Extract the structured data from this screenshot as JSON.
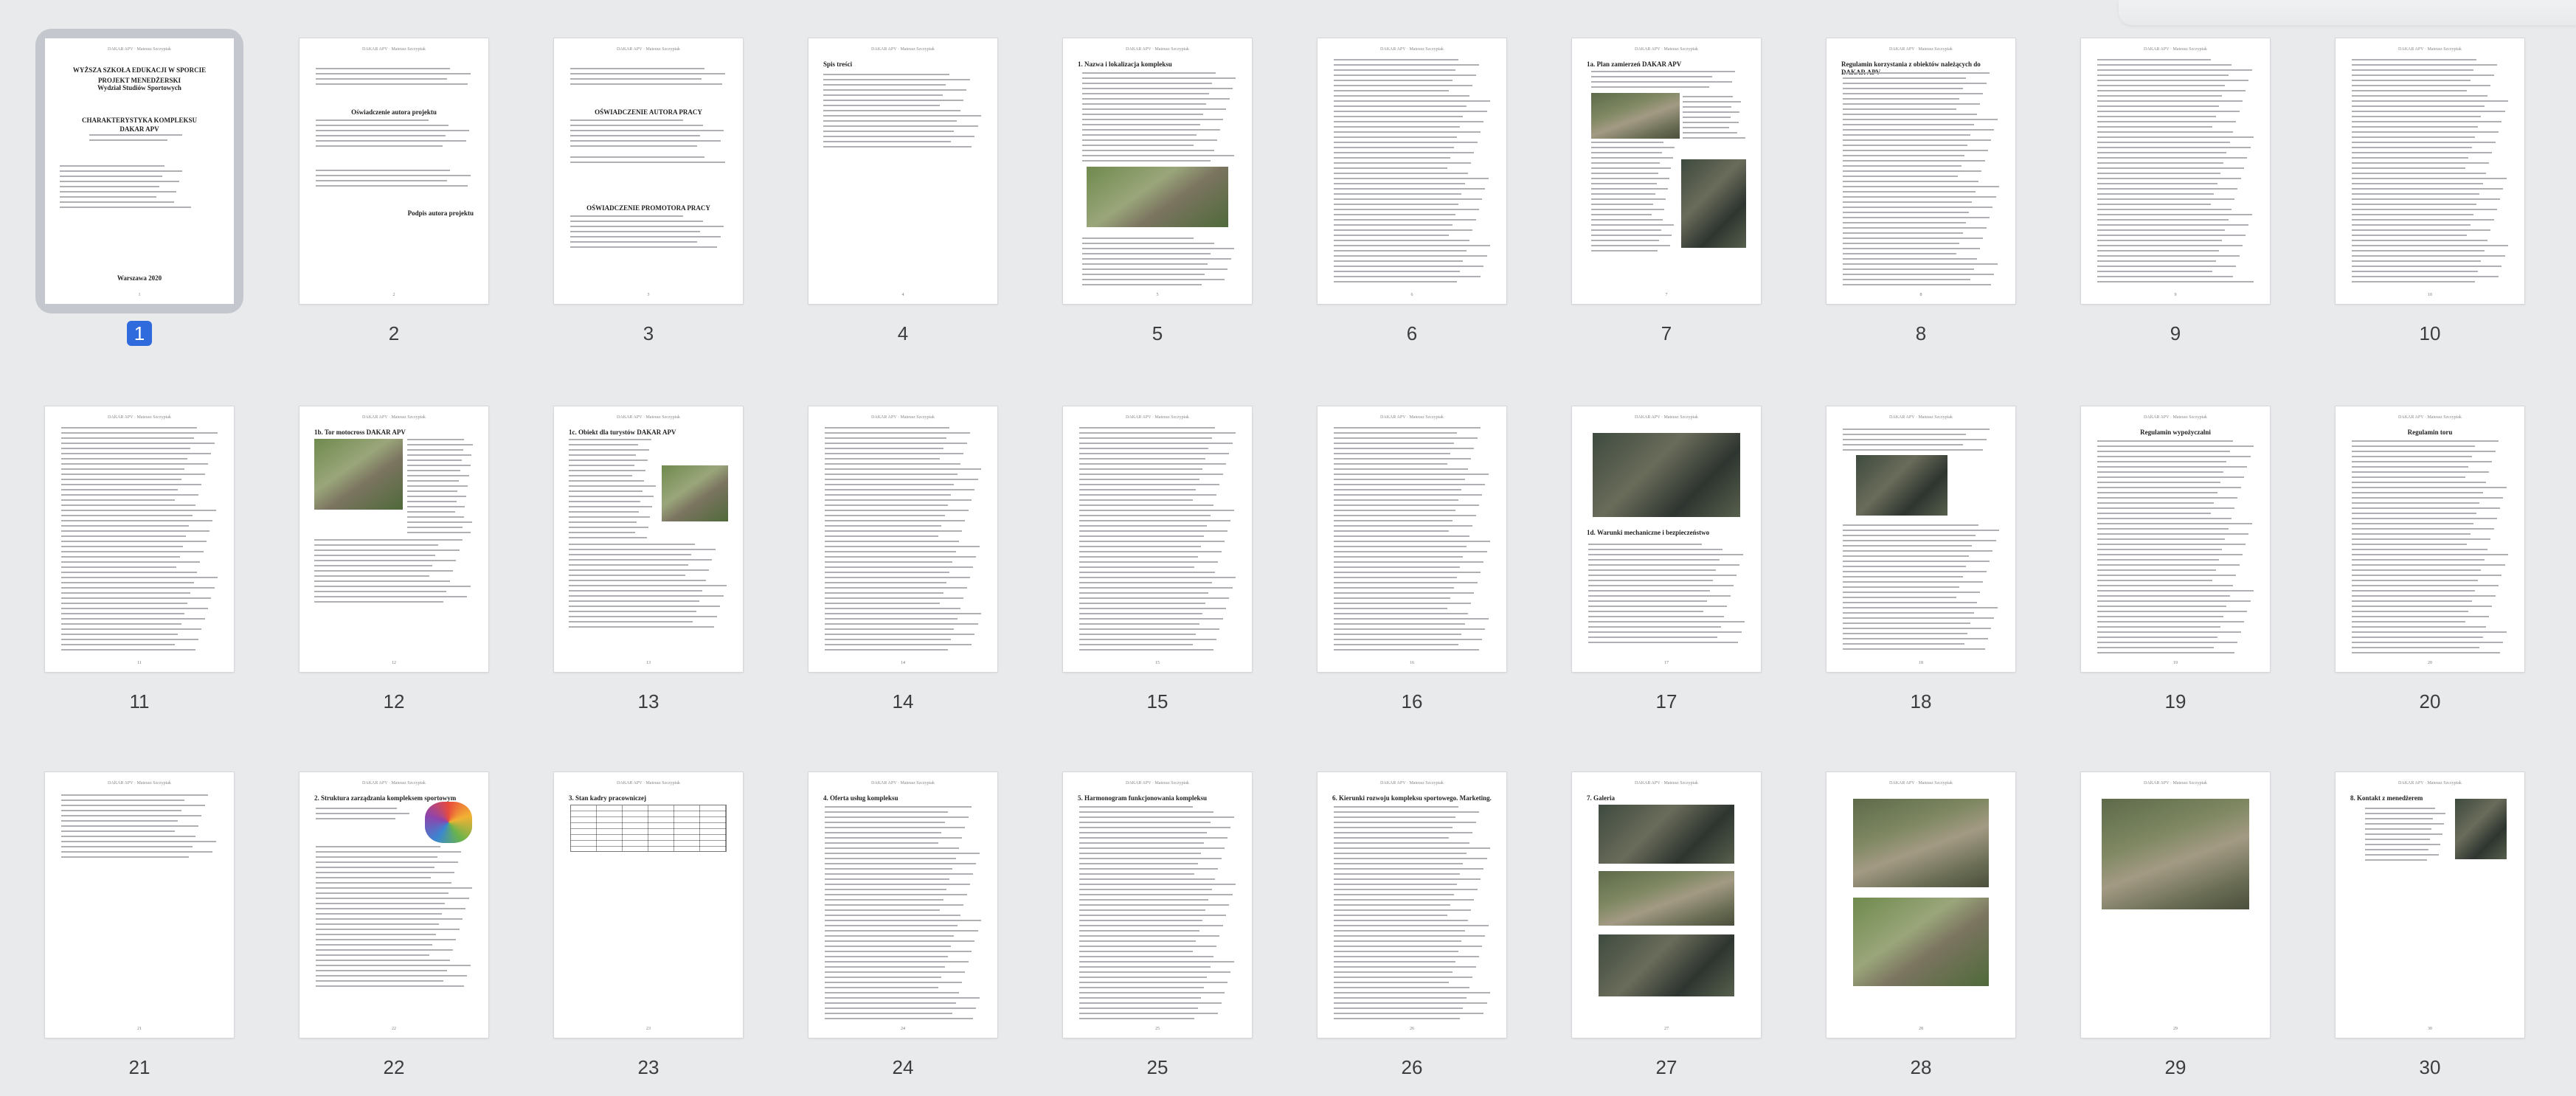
{
  "viewer": {
    "selected_page": "1"
  },
  "pages": [
    {
      "num": "1",
      "kind": "cover",
      "lines": [
        "WYŻSZA SZKOŁA EDUKACJI W SPORCIE",
        "PROJEKT MENEDŻERSKI",
        "Wydział Studiów Sportowych",
        "CHARAKTERYSTYKA KOMPLEKSU",
        "DAKAR APV",
        "Warszawa 2020"
      ]
    },
    {
      "num": "2",
      "kind": "statement",
      "lines": [
        "Oświadczenie autora projektu",
        "Podpis autora projektu"
      ]
    },
    {
      "num": "3",
      "kind": "statement",
      "lines": [
        "OŚWIADCZENIE AUTORA PRACY",
        "OŚWIADCZENIE PROMOTORA PRACY"
      ]
    },
    {
      "num": "4",
      "kind": "toc",
      "lines": [
        "Spis treści"
      ]
    },
    {
      "num": "5",
      "kind": "text-photo",
      "lines": [
        "1. Nazwa i lokalizacja kompleksu"
      ]
    },
    {
      "num": "6",
      "kind": "text",
      "lines": []
    },
    {
      "num": "7",
      "kind": "photos-text",
      "lines": [
        "1a. Plan zamierzeń DAKAR APV"
      ]
    },
    {
      "num": "8",
      "kind": "text",
      "lines": [
        "Regulamin korzystania z obiektów należących do DAKAR APV"
      ]
    },
    {
      "num": "9",
      "kind": "text",
      "lines": []
    },
    {
      "num": "10",
      "kind": "text",
      "lines": []
    },
    {
      "num": "11",
      "kind": "text",
      "lines": []
    },
    {
      "num": "12",
      "kind": "photo-left",
      "lines": [
        "1b. Tor motocross DAKAR APV"
      ]
    },
    {
      "num": "13",
      "kind": "photo-right",
      "lines": [
        "1c. Obiekt dla turystów DAKAR APV"
      ]
    },
    {
      "num": "14",
      "kind": "text",
      "lines": []
    },
    {
      "num": "15",
      "kind": "text",
      "lines": []
    },
    {
      "num": "16",
      "kind": "text",
      "lines": []
    },
    {
      "num": "17",
      "kind": "photo-top",
      "lines": [
        "1d. Warunki mechaniczne i bezpieczeństwo"
      ]
    },
    {
      "num": "18",
      "kind": "photo-top-small",
      "lines": []
    },
    {
      "num": "19",
      "kind": "text",
      "lines": [
        "Regulamin wypożyczalni"
      ]
    },
    {
      "num": "20",
      "kind": "text",
      "lines": [
        "Regulamin toru"
      ]
    },
    {
      "num": "21",
      "kind": "text-short",
      "lines": []
    },
    {
      "num": "22",
      "kind": "org",
      "lines": [
        "2. Struktura zarządzania kompleksem sportowym"
      ]
    },
    {
      "num": "23",
      "kind": "table",
      "lines": [
        "3. Stan kadry pracowniczej"
      ]
    },
    {
      "num": "24",
      "kind": "text",
      "lines": [
        "4. Oferta usług kompleksu"
      ]
    },
    {
      "num": "25",
      "kind": "text",
      "lines": [
        "5. Harmonogram funkcjonowania kompleksu"
      ]
    },
    {
      "num": "26",
      "kind": "text",
      "lines": [
        "6. Kierunki rozwoju kompleksu sportowego. Marketing."
      ]
    },
    {
      "num": "27",
      "kind": "gallery3",
      "lines": [
        "7. Galeria"
      ]
    },
    {
      "num": "28",
      "kind": "gallery2",
      "lines": []
    },
    {
      "num": "29",
      "kind": "gallery1",
      "lines": []
    },
    {
      "num": "30",
      "kind": "contact",
      "lines": [
        "8. Kontakt z menedżerem"
      ]
    }
  ],
  "colors": {
    "selection": "#2f6bdc",
    "photo_green": "#6f8a4e",
    "photo_track": "#8a7d6a"
  }
}
